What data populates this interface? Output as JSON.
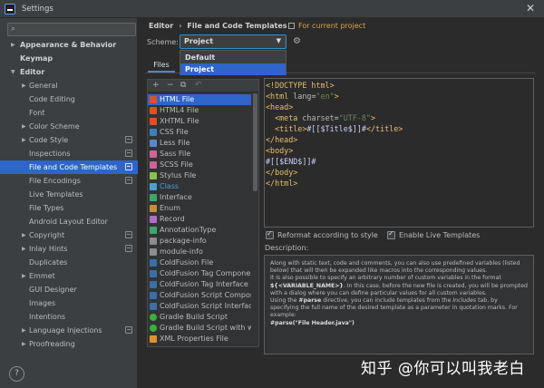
{
  "window": {
    "title": "Settings",
    "close_glyph": "✕"
  },
  "search": {
    "icon": "search-icon",
    "placeholder": ""
  },
  "sidebar": {
    "items": [
      {
        "label": "Appearance & Behavior",
        "expanded": false,
        "bold": true
      },
      {
        "label": "Keymap",
        "bold": true
      },
      {
        "label": "Editor",
        "expanded": true,
        "bold": true
      },
      {
        "label": "General",
        "expanded": false
      },
      {
        "label": "Code Editing"
      },
      {
        "label": "Font"
      },
      {
        "label": "Color Scheme",
        "expanded": false
      },
      {
        "label": "Code Style",
        "expanded": false
      },
      {
        "label": "Inspections"
      },
      {
        "label": "File and Code Templates",
        "selected": true
      },
      {
        "label": "File Encodings"
      },
      {
        "label": "Live Templates"
      },
      {
        "label": "File Types"
      },
      {
        "label": "Android Layout Editor"
      },
      {
        "label": "Copyright",
        "expanded": false
      },
      {
        "label": "Inlay Hints",
        "expanded": false
      },
      {
        "label": "Duplicates"
      },
      {
        "label": "Emmet",
        "expanded": false
      },
      {
        "label": "GUI Designer"
      },
      {
        "label": "Images"
      },
      {
        "label": "Intentions"
      },
      {
        "label": "Language Injections",
        "expanded": false
      },
      {
        "label": "Proofreading",
        "expanded": false
      }
    ],
    "help_glyph": "?"
  },
  "header": {
    "breadcrumb_root": "Editor",
    "breadcrumb_sep": "›",
    "breadcrumb_leaf": "File and Code Templates",
    "for_current_project": "For current project"
  },
  "scheme": {
    "label": "Scheme:",
    "selected": "Project",
    "options": [
      "Default",
      "Project"
    ]
  },
  "tabs": {
    "files": "Files"
  },
  "toolbar": {
    "add": "+",
    "remove": "−",
    "copy": "⧉",
    "reset": "↶"
  },
  "templates": [
    {
      "name": "HTML File",
      "selected": true,
      "color": "#e44d26"
    },
    {
      "name": "HTML4 File",
      "color": "#e44d26"
    },
    {
      "name": "XHTML File",
      "color": "#e44d26"
    },
    {
      "name": "CSS File",
      "color": "#3c7fc1"
    },
    {
      "name": "Less File",
      "color": "#5a8ac6"
    },
    {
      "name": "Sass File",
      "color": "#cf649a"
    },
    {
      "name": "SCSS File",
      "color": "#cf649a"
    },
    {
      "name": "Stylus File",
      "color": "#8bc34a"
    },
    {
      "name": "Class",
      "color": "#4a9fd5",
      "class_style": true
    },
    {
      "name": "Interface",
      "color": "#3ea56e"
    },
    {
      "name": "Enum",
      "color": "#c58f36"
    },
    {
      "name": "Record",
      "color": "#b06dc2"
    },
    {
      "name": "AnnotationType",
      "color": "#3ea56e"
    },
    {
      "name": "package-info",
      "color": "#8c8c8c"
    },
    {
      "name": "module-info",
      "color": "#8c8c8c"
    },
    {
      "name": "ColdFusion File",
      "color": "#3b6ea5"
    },
    {
      "name": "ColdFusion Tag Component",
      "color": "#3b6ea5"
    },
    {
      "name": "ColdFusion Tag Interface",
      "color": "#3b6ea5"
    },
    {
      "name": "ColdFusion Script Component",
      "color": "#3b6ea5"
    },
    {
      "name": "ColdFusion Script Interface",
      "color": "#3b6ea5"
    },
    {
      "name": "Gradle Build Script",
      "color": "#3ab03a",
      "round": true
    },
    {
      "name": "Gradle Build Script with wrapper",
      "color": "#3ab03a",
      "round": true
    },
    {
      "name": "XML Properties File",
      "color": "#e0912e"
    }
  ],
  "editor": {
    "lines": [
      [
        {
          "c": "t-doct",
          "t": "<!DOCTYPE html>"
        }
      ],
      [
        {
          "c": "t-tag",
          "t": "<html "
        },
        {
          "c": "t-attr",
          "t": "lang"
        },
        {
          "c": "t-txt",
          "t": "="
        },
        {
          "c": "t-val",
          "t": "\"en\""
        },
        {
          "c": "t-tag",
          "t": ">"
        }
      ],
      [
        {
          "c": "t-tag",
          "t": "<head>"
        }
      ],
      [
        {
          "c": "t-txt",
          "t": "  "
        },
        {
          "c": "t-tag",
          "t": "<meta "
        },
        {
          "c": "t-attr",
          "t": "charset"
        },
        {
          "c": "t-txt",
          "t": "="
        },
        {
          "c": "t-val",
          "t": "\"UTF-8\""
        },
        {
          "c": "t-tag",
          "t": ">"
        }
      ],
      [
        {
          "c": "t-txt",
          "t": "  "
        },
        {
          "c": "t-tag",
          "t": "<title>"
        },
        {
          "c": "t-var",
          "t": "#[[$Title$]]#"
        },
        {
          "c": "t-tag",
          "t": "</title>"
        }
      ],
      [
        {
          "c": "t-tag",
          "t": "</head>"
        }
      ],
      [
        {
          "c": "t-tag",
          "t": "<body>"
        }
      ],
      [
        {
          "c": "t-var",
          "t": "#[[$END$]]#"
        }
      ],
      [
        {
          "c": "t-tag",
          "t": "</body>"
        }
      ],
      [
        {
          "c": "t-tag",
          "t": "</html>"
        }
      ]
    ]
  },
  "options": {
    "reformat": "Reformat according to style",
    "live_templates": "Enable Live Templates"
  },
  "description": {
    "label": "Description:",
    "p1": "Along with static text, code and comments, you can also use predefined variables (listed below) that will then be expanded like macros into the corresponding values.",
    "p2_a": "It is also possible to specify an arbitrary number of custom variables in the format ",
    "p2_b": "${<VARIABLE_NAME>}",
    "p2_c": ". In this case, before the new file is created, you will be prompted with a dialog where you can define particular values for all custom variables.",
    "p3_a": "Using the ",
    "p3_b": "#parse",
    "p3_c": " directive, you can include templates from the ",
    "p3_d": "Includes",
    "p3_e": " tab, by specifying the full name of the desired template as a parameter in quotation marks. For example:",
    "p4": "#parse(\"File Header.java\")"
  },
  "watermark": "知乎 @你可以叫我老白"
}
